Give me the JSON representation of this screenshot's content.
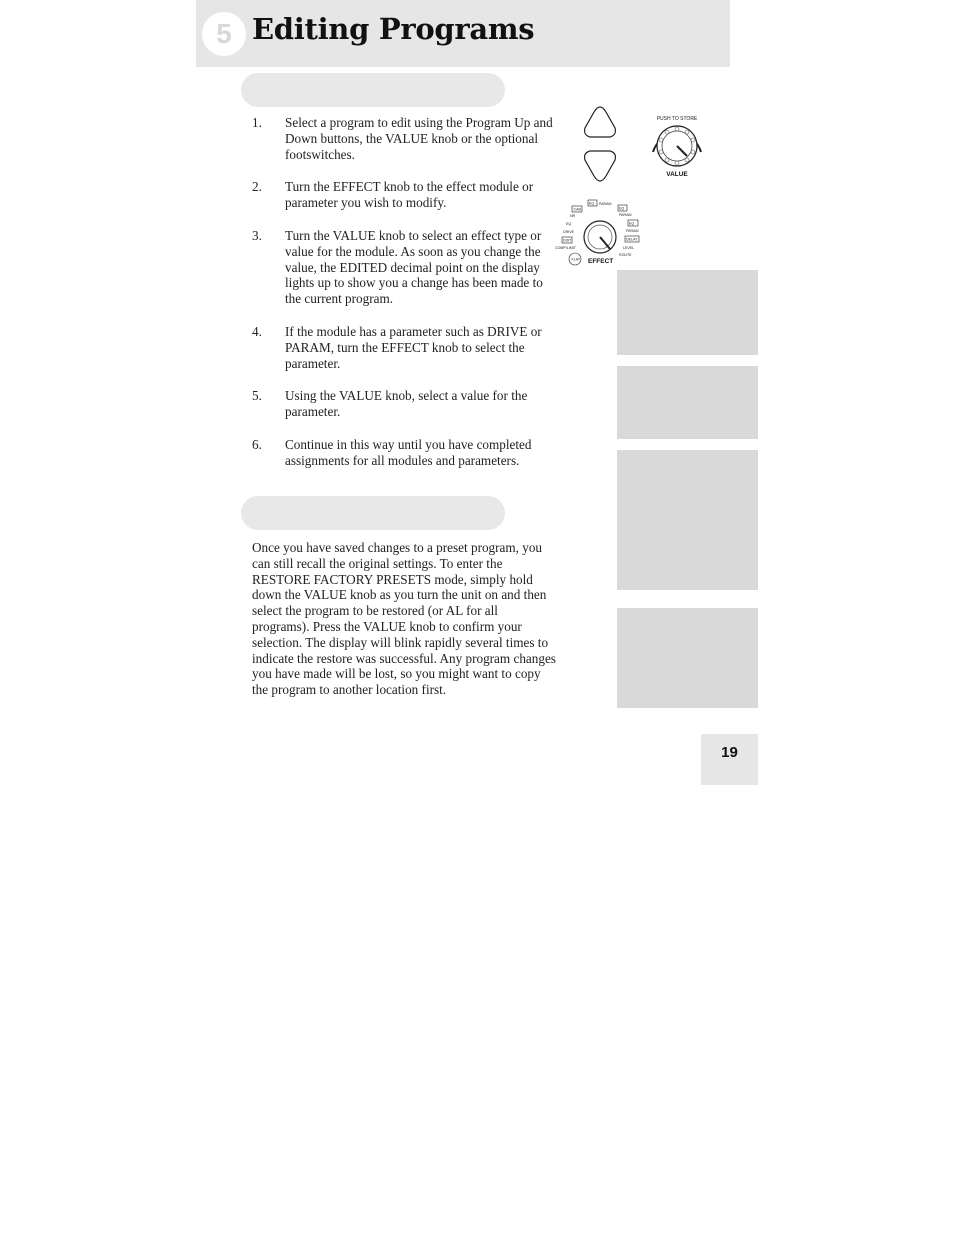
{
  "header": {
    "chapter_number": "5",
    "title": "Editing Programs"
  },
  "steps": [
    {
      "num": "1.",
      "text": "Select a program to edit using the Program Up and Down buttons, the VALUE knob or the optional footswitches."
    },
    {
      "num": "2.",
      "text": "Turn the EFFECT knob to the effect module or parameter you wish to modify."
    },
    {
      "num": "3.",
      "text": "Turn the VALUE knob to select an effect type or value for the module. As soon as you change the value, the EDITED decimal point on the display lights up to show you a change has been made to the current program."
    },
    {
      "num": "4.",
      "text": "If the module has a parameter such as DRIVE or PARAM, turn the EFFECT knob to select the parameter."
    },
    {
      "num": "5.",
      "text": "Using the VALUE knob, select a value for the parameter."
    },
    {
      "num": "6.",
      "text": "Continue in this way until you have completed assignments for all modules and parameters."
    }
  ],
  "restore_paragraph": "Once you have saved changes to a preset program, you can still recall the original settings. To enter the RESTORE FACTORY PRESETS mode, simply hold down the VALUE knob as you turn the unit on and then select the program to be restored (or AL for all programs). Press the VALUE knob to confirm your selection. The display will blink rapidly several times to indicate the restore was successful. Any program changes you have made will be lost, so you might want to copy the program to another location first.",
  "value_knob": {
    "label": "VALUE",
    "arc_label": "PUSH TO STORE"
  },
  "effect_knob": {
    "label": "EFFECT",
    "labels_left": [
      "CAB",
      "NR",
      "EQ",
      "DRIVE",
      "DIST",
      "COMP/LIMIT",
      "FLAT"
    ],
    "labels_right": [
      "PARAM",
      "PARAM",
      "PARAM",
      "LEVEL",
      "ROUTE"
    ],
    "boxed_right": [
      "EQ",
      "EQ",
      "EQ",
      "DELAY"
    ]
  },
  "page_number": "19"
}
